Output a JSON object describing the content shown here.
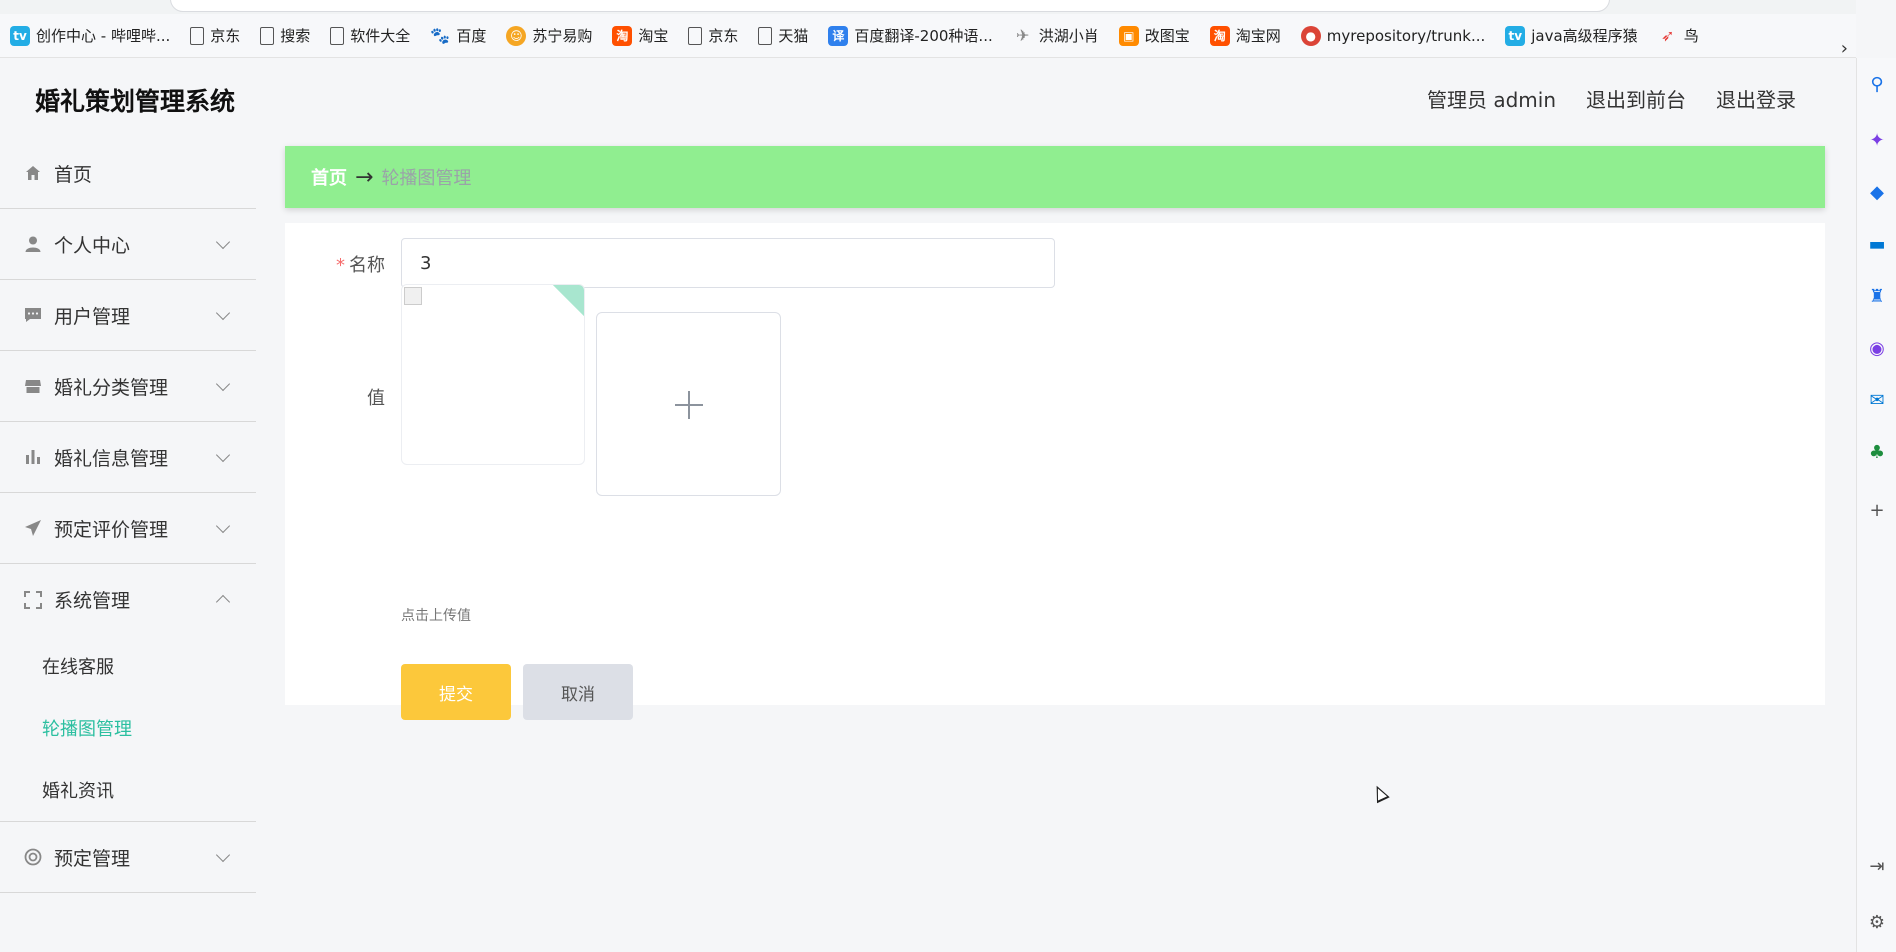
{
  "browser": {
    "bookmarks": [
      {
        "label": "创作中心 - 哔哩哔...",
        "icon": "bilibili-icon",
        "color": "#23ade5"
      },
      {
        "label": "京东",
        "icon": "page-icon",
        "color": "#666666"
      },
      {
        "label": "搜索",
        "icon": "page-icon",
        "color": "#666666"
      },
      {
        "label": "软件大全",
        "icon": "page-icon",
        "color": "#666666"
      },
      {
        "label": "百度",
        "icon": "baidu-icon",
        "color": "#2932e1"
      },
      {
        "label": "苏宁易购",
        "icon": "suning-icon",
        "color": "#f5a623"
      },
      {
        "label": "淘宝",
        "icon": "taobao-icon",
        "color": "#ff5000"
      },
      {
        "label": "京东",
        "icon": "page-icon",
        "color": "#666666"
      },
      {
        "label": "天猫",
        "icon": "page-icon",
        "color": "#666666"
      },
      {
        "label": "百度翻译-200种语...",
        "icon": "translate-icon",
        "color": "#2f80ed"
      },
      {
        "label": "洪湖小肖",
        "icon": "bird-icon",
        "color": "#888888"
      },
      {
        "label": "改图宝",
        "icon": "gaitubao-icon",
        "color": "#ff8a00"
      },
      {
        "label": "淘宝网",
        "icon": "taobao-icon",
        "color": "#ff5000"
      },
      {
        "label": "myrepository/trunk...",
        "icon": "chrome-icon",
        "color": "#db4437"
      },
      {
        "label": "java高级程序猿",
        "icon": "bilibili-icon",
        "color": "#23ade5"
      },
      {
        "label": "鸟",
        "icon": "bird-red-icon",
        "color": "#e53935"
      }
    ]
  },
  "app": {
    "title": "婚礼策划管理系统",
    "header_links": {
      "admin": "管理员 admin",
      "front": "退出到前台",
      "logout": "退出登录"
    },
    "menu": [
      {
        "label": "首页",
        "icon": "home-icon",
        "expandable": false
      },
      {
        "label": "个人中心",
        "icon": "user-icon",
        "expandable": true
      },
      {
        "label": "用户管理",
        "icon": "chat-icon",
        "expandable": true
      },
      {
        "label": "婚礼分类管理",
        "icon": "store-icon",
        "expandable": true
      },
      {
        "label": "婚礼信息管理",
        "icon": "bar-chart-icon",
        "expandable": true
      },
      {
        "label": "预定评价管理",
        "icon": "send-icon",
        "expandable": true
      },
      {
        "label": "系统管理",
        "icon": "fullscreen-icon",
        "expandable": true,
        "expanded": true,
        "children": [
          "在线客服",
          "轮播图管理",
          "婚礼资讯"
        ],
        "active_child": "轮播图管理"
      },
      {
        "label": "预定管理",
        "icon": "lifebuoy-icon",
        "expandable": true
      }
    ],
    "breadcrumb": {
      "home": "首页",
      "arrow": "→",
      "current": "轮播图管理"
    },
    "form": {
      "name_label": "名称",
      "name_value": "3",
      "required_mark": "*",
      "value_label": "值",
      "upload_hint": "点击上传值",
      "submit": "提交",
      "cancel": "取消"
    },
    "colors": {
      "accent": "#2bbfa0",
      "breadcrumb_bg": "#90ee90",
      "submit": "#fcc83b"
    }
  }
}
